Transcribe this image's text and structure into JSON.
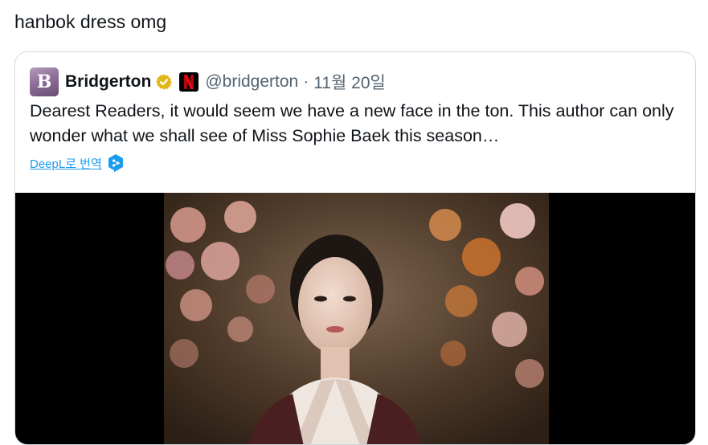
{
  "post": {
    "text": "hanbok dress omg"
  },
  "quote": {
    "avatar_letter": "B",
    "author": "Bridgerton",
    "handle": "@bridgerton",
    "separator": "·",
    "time": "11월 20일",
    "text": "Dearest Readers, it would seem we have a new face in the ton. This author can only wonder what we shall see of Miss Sophie Baek this season…",
    "translate_label": "DeepL로 번역",
    "affiliate_letter": "N"
  },
  "icons": {
    "verified": "verified-badge-icon",
    "affiliate": "netflix-logo-icon",
    "deepl": "deepl-icon"
  },
  "colors": {
    "link": "#1d9bf0",
    "muted": "#536471",
    "verified": "#e2b719",
    "netflix": "#e50914"
  }
}
